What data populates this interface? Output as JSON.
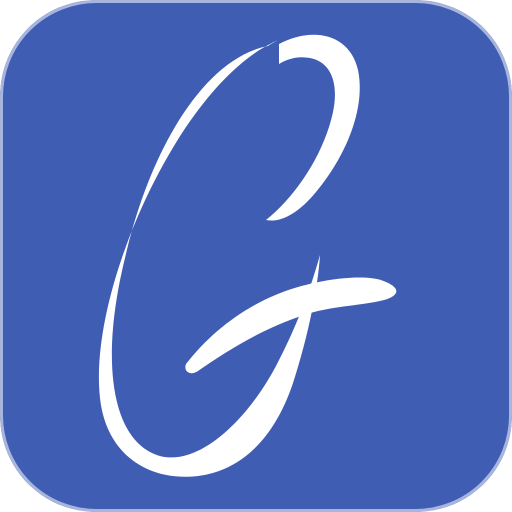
{
  "icon": {
    "name": "G app icon",
    "glyph": "G",
    "colors": {
      "background": "#3F5DB3",
      "glyph": "#FFFFFF",
      "edge": "#FFFFFF"
    }
  }
}
